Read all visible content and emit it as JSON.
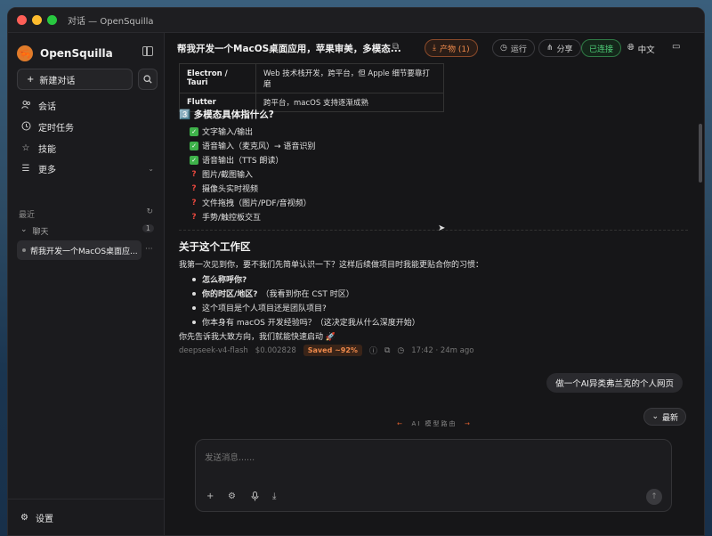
{
  "window": {
    "title": "对话 — OpenSquilla"
  },
  "sidebar": {
    "brand": "OpenSquilla",
    "brand_logo": "🦐",
    "new_chat": "新建对话",
    "nav": [
      {
        "label": "会话",
        "icon": "user-icon"
      },
      {
        "label": "定时任务",
        "icon": "clock-icon"
      },
      {
        "label": "技能",
        "icon": "star-icon"
      },
      {
        "label": "更多",
        "icon": "menu-icon"
      }
    ],
    "recent_label": "最近",
    "group_label": "聊天",
    "group_count": "1",
    "conversations": [
      {
        "title": "帮我开发一个MacOS桌面应..."
      }
    ],
    "settings": "设置"
  },
  "header": {
    "title": "帮我开发一个MacOS桌面应用，苹果审美，多模态...",
    "products": "产物 (1)",
    "run": "运行",
    "share": "分享",
    "status": "已连接",
    "language": "中文"
  },
  "message": {
    "table": [
      {
        "k": "Electron / Tauri",
        "v": "Web 技术栈开发，跨平台，但 Apple 细节要靠打磨"
      },
      {
        "k": "Flutter",
        "v": "跨平台，macOS 支持逐渐成熟"
      }
    ],
    "section3_title": "3️⃣ 多模态具体指什么?",
    "section3_items": [
      {
        "mark": "check",
        "text": "文字输入/输出"
      },
      {
        "mark": "check",
        "text": "语音输入（麦克风）→ 语音识别"
      },
      {
        "mark": "check",
        "text": "语音输出（TTS 朗读）"
      },
      {
        "mark": "q",
        "text": "图片/截图输入"
      },
      {
        "mark": "q",
        "text": "摄像头实时视频"
      },
      {
        "mark": "q",
        "text": "文件拖拽（图片/PDF/音视频）"
      },
      {
        "mark": "q",
        "text": "手势/触控板交互"
      }
    ],
    "section_about_title": "关于这个工作区",
    "about_intro": "我第一次见到你，要不我们先简单认识一下？这样后续做项目时我能更贴合你的习惯：",
    "about_items": [
      {
        "bold": "怎么称呼你?",
        "rest": ""
      },
      {
        "bold": "你的时区/地区?",
        "rest": "（我看到你在 CST 时区）"
      },
      {
        "bold": "",
        "rest": "这个项目是个人项目还是团队项目?"
      },
      {
        "bold": "",
        "rest": "你本身有 macOS 开发经验吗？（这决定我从什么深度开始）"
      }
    ],
    "closing": "你先告诉我大致方向，我们就能快速启动 🚀",
    "meta": {
      "model": "deepseek-v4-flash",
      "cost": "$0.002828",
      "saved": "Saved ~92%",
      "time": "17:42 · 24m ago"
    }
  },
  "user_message": "做一个AI异类弗兰克的个人网页",
  "latest_button": "最新",
  "route_label": "AI 模型路由",
  "composer": {
    "placeholder": "发送消息......"
  },
  "colors": {
    "accent": "#f08a4b",
    "connected": "#4fd27a",
    "check": "#3eb24a",
    "question": "#e8483e"
  }
}
